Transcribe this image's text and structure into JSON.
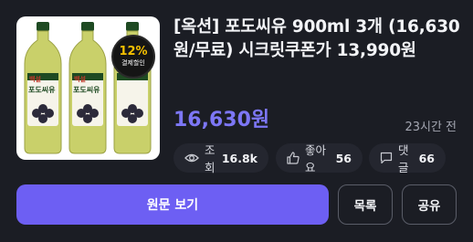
{
  "product": {
    "title": "[옥션] 포도씨유 900ml 3개 (16,630원/무료) 시크릿쿠폰가 13,990원",
    "price": "16,630원",
    "posted": "23시간 전",
    "image": {
      "bottle_label_brand": "백설",
      "bottle_label_name": "포도씨유",
      "badge_percent": "12%",
      "badge_text": "결제할인",
      "oil_color": "#c9d06a",
      "cap_color": "#1e4a22"
    }
  },
  "stats": {
    "views_label": "조회",
    "views_value": "16.8k",
    "likes_label": "좋아요",
    "likes_value": "56",
    "comments_label": "댓글",
    "comments_value": "66"
  },
  "actions": {
    "primary_label": "원문 보기",
    "list_label": "목록",
    "share_label": "공유"
  },
  "colors": {
    "background": "#1b1d24",
    "accent": "#6d5ff3",
    "price": "#7d77f6",
    "chip_bg": "#24262f"
  }
}
